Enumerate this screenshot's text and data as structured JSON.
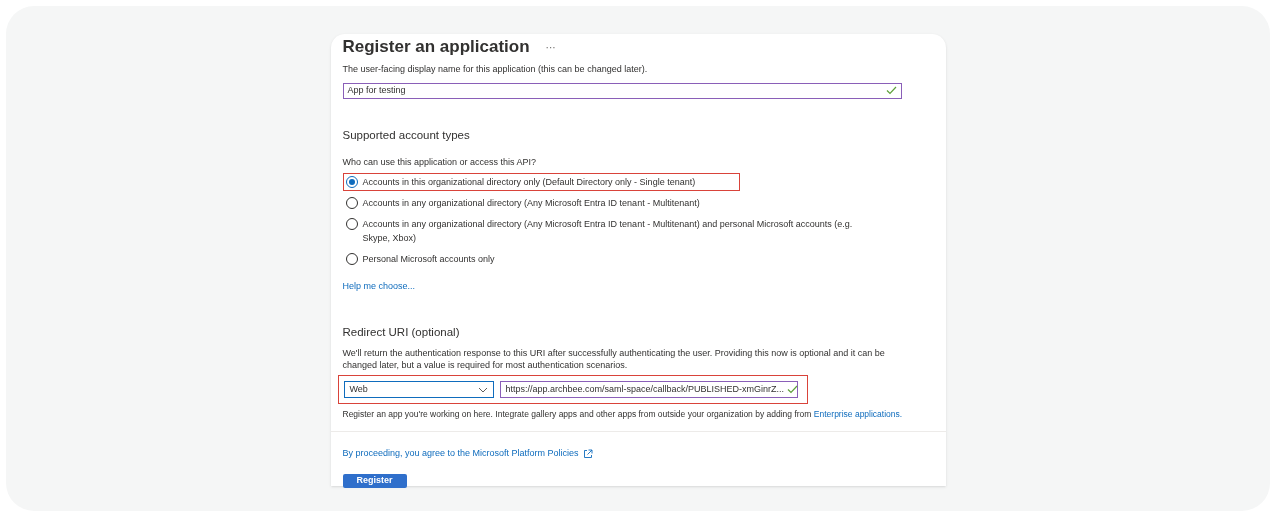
{
  "title": "Register an application",
  "more": "···",
  "name_field": {
    "hint": "The user-facing display name for this application (this can be changed later).",
    "value": "App for testing",
    "valid": true
  },
  "account_types": {
    "heading": "Supported account types",
    "question": "Who can use this application or access this API?",
    "options": [
      {
        "label": "Accounts in this organizational directory only (Default Directory only - Single tenant)",
        "selected": true,
        "highlighted": true
      },
      {
        "label": "Accounts in any organizational directory (Any Microsoft Entra ID tenant - Multitenant)",
        "selected": false,
        "highlighted": false
      },
      {
        "label": "Accounts in any organizational directory (Any Microsoft Entra ID tenant - Multitenant) and personal Microsoft accounts (e.g. Skype, Xbox)",
        "selected": false,
        "highlighted": false
      },
      {
        "label": "Personal Microsoft accounts only",
        "selected": false,
        "highlighted": false
      }
    ],
    "help_link": "Help me choose..."
  },
  "redirect": {
    "heading": "Redirect URI (optional)",
    "description": "We'll return the authentication response to this URI after successfully authenticating the user. Providing this now is optional and it can be changed later, but a value is required for most authentication scenarios.",
    "platform": "Web",
    "uri": "https://app.archbee.com/saml-space/callback/PUBLISHED-xmGinrZ...",
    "valid": true,
    "highlighted": true,
    "note": "Register an app you're working on here. Integrate gallery apps and other apps from outside your organization by adding from",
    "note_link": "Enterprise applications."
  },
  "policy_link": "By proceeding, you agree to the Microsoft Platform Policies",
  "register_button": "Register"
}
